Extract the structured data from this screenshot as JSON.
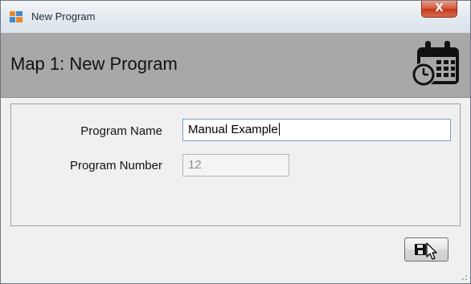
{
  "window": {
    "title": "New Program",
    "close_label": "X"
  },
  "header": {
    "title": "Map 1: New Program",
    "icon": "calendar-clock-icon"
  },
  "form": {
    "program_name_label": "Program Name",
    "program_name_value": "Manual Example",
    "program_number_label": "Program Number",
    "program_number_value": "12"
  },
  "footer": {
    "save_icon": "save-cursor-icon"
  },
  "colors": {
    "header_bg": "#a8a8a8",
    "window_bg": "#f0f0f0",
    "input_border": "#7a9ec4",
    "close_red": "#c4371b"
  }
}
